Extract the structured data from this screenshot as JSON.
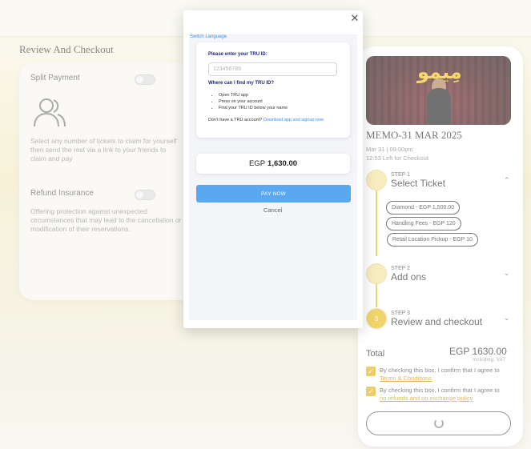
{
  "page": {
    "heading": "Review And Checkout"
  },
  "left": {
    "split_title": "Split Payment",
    "split_text": "Select any number of tickets to claim for yourself then send the rest via a link to your friends to claim and pay",
    "refund_title": "Refund Insurance",
    "refund_text": "Offering protection against unexpected circumstances that may lead to the cancellation or modification of their reservations."
  },
  "event": {
    "poster_logo": "مِيمو",
    "title": "MEMO-31 MAR 2025",
    "date": "Mar 31 | 09:00pm",
    "time_left": "12:53 Left for Checkout"
  },
  "steps": [
    {
      "small": "STEP 1",
      "label": "Select Ticket"
    },
    {
      "small": "STEP 2",
      "label": "Add ons"
    },
    {
      "small": "STEP 3",
      "label": "Review and checkout",
      "number": "3"
    }
  ],
  "tickets": [
    "Diamond - EGP 1,500.00",
    "Handling Fees - EGP 120",
    "Retail Location Pickup - EGP 10"
  ],
  "total": {
    "label": "Total",
    "value": "EGP 1630.00",
    "vat": "Including. VAT"
  },
  "checks": [
    {
      "text": "By checking this box, I confirm that I agree to ",
      "link": "Terms & Conditions"
    },
    {
      "text": "By checking this box, I confirm that I agree to ",
      "link": "no refunds and no exchange policy"
    }
  ],
  "modal": {
    "switch_language": "Switch Language",
    "tru_title": "Please enter your TRU ID:",
    "tru_placeholder": "123456789",
    "where_title": "Where can I find my TRU ID?",
    "instructions": [
      "Open TRU app",
      "Press on your account",
      "Find your TRU ID below your name"
    ],
    "no_account": "Don't have a TRU account?",
    "download_link": "Download app and signup now",
    "price_currency": "EGP",
    "price_amount": "1,630.00",
    "pay_now": "PAY NOW",
    "cancel": "Cancel"
  },
  "colors": {
    "accent": "#E3AD0F",
    "pay_button": "#5AA9F0",
    "link": "#3D8FE0"
  }
}
